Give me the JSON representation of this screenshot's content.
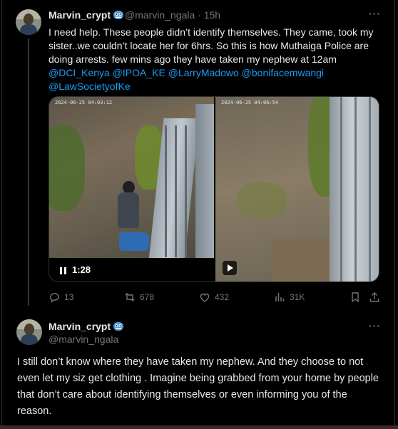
{
  "post1": {
    "name": "Marvin_crypt",
    "handle_time": "@marvin_ngala · 15h",
    "text_intro": "I need help. These people didn’t identify themselves. They came, took my sister..we couldn’t locate her for 6hrs. So this is how Muthaiga Police are doing arrests. few mins ago they have taken my nephew  at 12am",
    "mentions": [
      "@DCI_Kenya",
      "@IPOA_KE",
      "@LarryMadowo",
      "@bonifacemwangi",
      "@LawSocietyofKe"
    ],
    "video": {
      "duration": "1:28",
      "timestamp_overlay_1": "2024-06-25 04:03:12",
      "timestamp_overlay_2": "2024-06-25 04:06:54"
    },
    "stats": {
      "replies": "13",
      "reposts": "678",
      "likes": "432",
      "views": "31K"
    }
  },
  "post2": {
    "name": "Marvin_crypt",
    "handle": "@marvin_ngala",
    "text": "I still don’t know where they have taken my nephew. And they choose to not even let my siz get clothing . Imagine being grabbed from your home by people that don’t care about identifying themselves or even informing you of the reason."
  },
  "icons": {
    "badge": "emoji-badge-icon",
    "more": "more-options-icon",
    "reply": "reply-icon",
    "repost": "repost-icon",
    "like": "heart-icon",
    "views": "views-icon",
    "bookmark": "bookmark-icon",
    "share": "share-icon"
  },
  "colors": {
    "link": "#1d9bf0",
    "muted": "#71767b",
    "text": "#e7e9ea",
    "background": "#000000"
  }
}
